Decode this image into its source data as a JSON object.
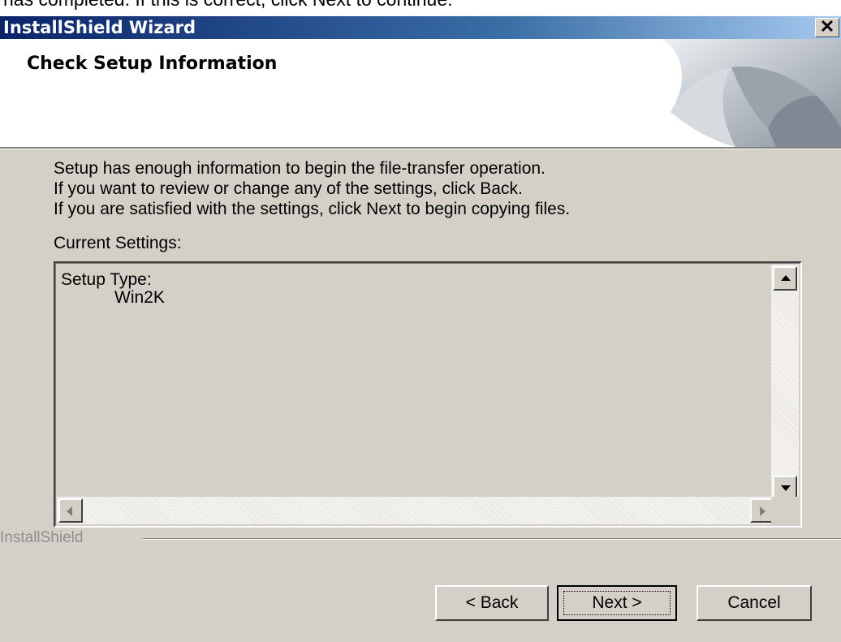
{
  "top_strip": {
    "text": "has completed. If this is correct, click Next to continue."
  },
  "window": {
    "title": "InstallShield Wizard",
    "close_glyph": "✕"
  },
  "header": {
    "title": "Check Setup Information"
  },
  "body": {
    "lines": [
      "Setup has enough information to begin the file-transfer operation.",
      "If you want to review or change any of the settings, click Back.",
      "If you are satisfied with the settings, click Next to begin copying files."
    ],
    "current_settings_label": "Current Settings:"
  },
  "settings_list": {
    "setup_type_label": "Setup Type:",
    "setup_type_value": "Win2K"
  },
  "footer": {
    "brand": "InstallShield",
    "back_label": "< Back",
    "next_label": "Next >",
    "cancel_label": "Cancel"
  },
  "colors": {
    "titlebar_start": "#0a246a",
    "titlebar_end": "#a6caf0",
    "face": "#d4d0c8"
  },
  "icons": [
    "close-icon",
    "scroll-up-icon",
    "scroll-down-icon",
    "scroll-left-icon",
    "scroll-right-icon"
  ]
}
